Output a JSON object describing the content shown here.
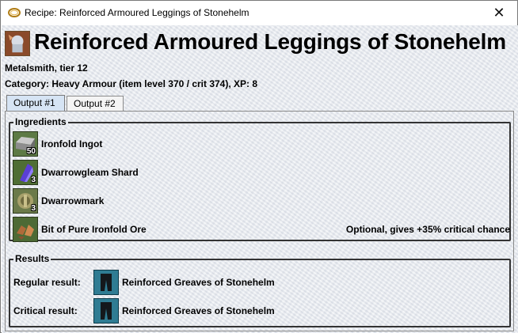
{
  "window": {
    "title": "Recipe: Reinforced Armoured Leggings of Stonehelm",
    "close_label": "✕"
  },
  "recipe": {
    "title": "Reinforced Armoured Leggings of Stonehelm",
    "profession": "Metalsmith, tier 12",
    "category": "Category: Heavy Armour (item level 370 / crit 374), XP: 8"
  },
  "tabs": [
    {
      "label": "Output #1",
      "active": true
    },
    {
      "label": "Output #2",
      "active": false
    }
  ],
  "ingredients": {
    "heading": "Ingredients",
    "items": [
      {
        "name": "Ironfold Ingot",
        "qty": "50",
        "icon": "ingot-icon",
        "note": ""
      },
      {
        "name": "Dwarrowgleam Shard",
        "qty": "3",
        "icon": "shard-icon",
        "note": ""
      },
      {
        "name": "Dwarrowmark",
        "qty": "3",
        "icon": "mark-icon",
        "note": ""
      },
      {
        "name": "Bit of Pure Ironfold Ore",
        "qty": "",
        "icon": "ore-icon",
        "note": "Optional, gives +35% critical chance"
      }
    ]
  },
  "results": {
    "heading": "Results",
    "rows": [
      {
        "label": "Regular result:",
        "name": "Reinforced Greaves of Stonehelm",
        "icon": "greaves-icon"
      },
      {
        "label": "Critical result:",
        "name": "Reinforced Greaves of Stonehelm",
        "icon": "greaves-icon"
      }
    ]
  }
}
